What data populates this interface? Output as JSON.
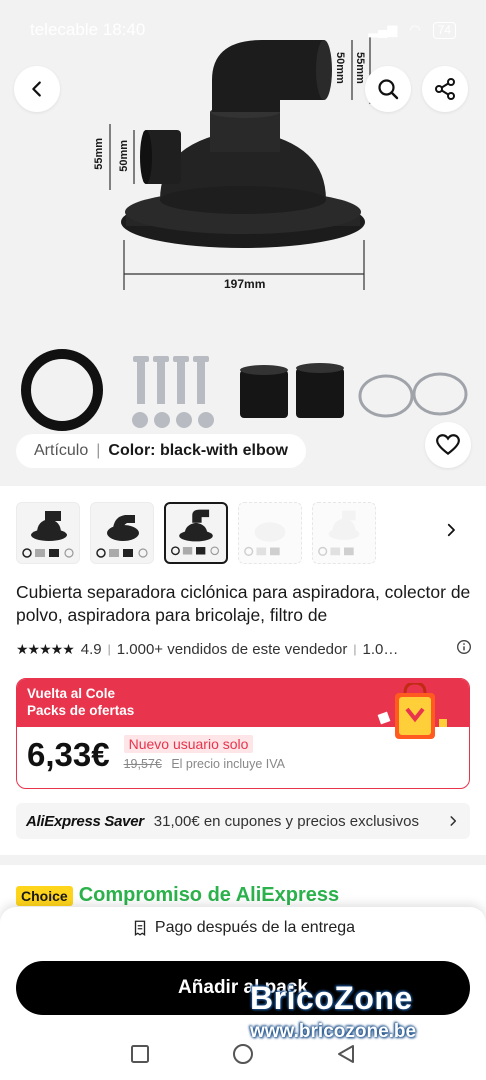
{
  "status": {
    "carrier": "telecable 18:40",
    "battery": "74"
  },
  "hero": {
    "dim_height_top_outer": "55mm",
    "dim_height_top_inner": "50mm",
    "dim_side_outer": "55mm",
    "dim_side_inner": "50mm",
    "dim_width": "197mm",
    "variant_label": "Artículo",
    "variant_value": "Color: black-with elbow"
  },
  "icons": {
    "back": "chevron-left-icon",
    "search": "search-icon",
    "share": "share-icon",
    "wishlist": "heart-icon",
    "next_thumb": "chevron-right-icon"
  },
  "product": {
    "title": "Cubierta separadora ciclónica para aspiradora, colector de polvo, aspiradora para bricolaje, filtro de",
    "rating": "4.9",
    "sold": "1.000+ vendidos de este vendedor",
    "extra": "1.0…",
    "info_icon": "info-icon"
  },
  "promo": {
    "title": "Vuelta al Cole",
    "subtitle": "Packs de ofertas",
    "price": "6,33€",
    "new_user": "Nuevo usuario solo",
    "old_price": "19,57€",
    "tax_note": "El precio incluye IVA",
    "accent": "#e8344c"
  },
  "saver": {
    "logo": "AliExpress Saver",
    "text": "31,00€ en cupones y precios exclusivos"
  },
  "choice": {
    "badge": "Choice",
    "commitment": "Compromiso de AliExpress",
    "color": "#2bb24c"
  },
  "sheet": {
    "pay_after": "Pago después de la entrega",
    "add_button": "Añadir al pack"
  },
  "watermark": {
    "brand": "BricoZone",
    "url": "www.bricozone.be"
  }
}
